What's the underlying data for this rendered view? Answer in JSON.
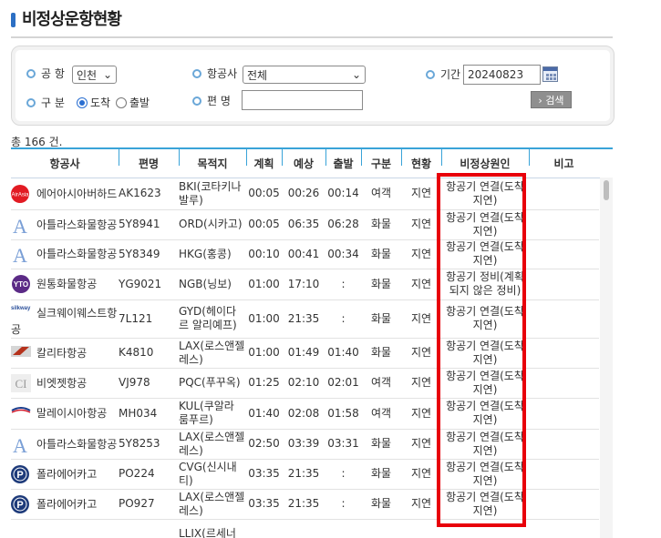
{
  "page": {
    "title": "비정상운항현황"
  },
  "search": {
    "airport_label": "공 항",
    "airport_value": "인천",
    "airline_label": "항공사",
    "airline_value": "전체",
    "period_label": "기간",
    "period_value": "20240823",
    "type_label": "구 분",
    "type_options": [
      "도착",
      "출발"
    ],
    "type_selected": "도착",
    "flight_label": "편 명",
    "flight_value": "",
    "search_button": "› 검색"
  },
  "total_text": "총 166 건.",
  "columns": [
    "항공사",
    "편명",
    "목적지",
    "계획",
    "예상",
    "출발",
    "구분",
    "현황",
    "비정상원인",
    "비고"
  ],
  "rows": [
    {
      "logo": "airasia-logo",
      "airline": [
        "에어아시아버하드"
      ],
      "flight": "AK1623",
      "dest": [
        "BKI(코타키나",
        "발루)"
      ],
      "plan": "00:05",
      "expect": "00:26",
      "depart": "00:14",
      "type": "여객",
      "status": "지연",
      "cause": [
        "항공기 연결(도착",
        "지연)"
      ],
      "note": ""
    },
    {
      "logo": "atlas-logo",
      "airline": [
        "아틀라스화물항공"
      ],
      "flight": "5Y8941",
      "dest": [
        "ORD(시카고)"
      ],
      "plan": "00:05",
      "expect": "06:35",
      "depart": "06:28",
      "type": "화물",
      "status": "지연",
      "cause": [
        "항공기 연결(도착",
        "지연)"
      ],
      "note": ""
    },
    {
      "logo": "atlas-logo",
      "airline": [
        "아틀라스화물항공"
      ],
      "flight": "5Y8349",
      "dest": [
        "HKG(홍콩)"
      ],
      "plan": "00:10",
      "expect": "00:41",
      "depart": "00:34",
      "type": "화물",
      "status": "지연",
      "cause": [
        "항공기 연결(도착",
        "지연)"
      ],
      "note": ""
    },
    {
      "logo": "yto-logo",
      "airline": [
        "원통화물항공"
      ],
      "flight": "YG9021",
      "dest": [
        "NGB(닝보)"
      ],
      "plan": "01:00",
      "expect": "17:10",
      "depart": ":",
      "type": "화물",
      "status": "지연",
      "cause": [
        "항공기 정비(계획",
        "되지 않은 정비)"
      ],
      "note": ""
    },
    {
      "logo": "silkway-logo",
      "airline": [
        "실크웨이웨스트항",
        "공"
      ],
      "flight": "7L121",
      "dest": [
        "GYD(헤이다",
        "르 알리예프)"
      ],
      "plan": "01:00",
      "expect": "21:35",
      "depart": ":",
      "type": "화물",
      "status": "지연",
      "cause": [
        "항공기 연결(도착",
        "지연)"
      ],
      "note": ""
    },
    {
      "logo": "kalitta-logo",
      "airline": [
        "칼리타항공"
      ],
      "flight": "K4810",
      "dest": [
        "LAX(로스앤젤",
        "레스)"
      ],
      "plan": "01:00",
      "expect": "01:49",
      "depart": "01:40",
      "type": "화물",
      "status": "지연",
      "cause": [
        "항공기 연결(도착",
        "지연)"
      ],
      "note": ""
    },
    {
      "logo": "vietjet-logo",
      "airline": [
        "비엣젯항공"
      ],
      "flight": "VJ978",
      "dest": [
        "PQC(푸꾸옥)"
      ],
      "plan": "01:25",
      "expect": "02:10",
      "depart": "02:01",
      "type": "여객",
      "status": "지연",
      "cause": [
        "항공기 연결(도착",
        "지연)"
      ],
      "note": ""
    },
    {
      "logo": "malaysia-logo",
      "airline": [
        "말레이시아항공"
      ],
      "flight": "MH034",
      "dest": [
        "KUL(쿠알라",
        "룸푸르)"
      ],
      "plan": "01:40",
      "expect": "02:08",
      "depart": "01:58",
      "type": "여객",
      "status": "지연",
      "cause": [
        "항공기 연결(도착",
        "지연)"
      ],
      "note": ""
    },
    {
      "logo": "atlas-logo",
      "airline": [
        "아틀라스화물항공"
      ],
      "flight": "5Y8253",
      "dest": [
        "LAX(로스앤젤",
        "레스)"
      ],
      "plan": "02:50",
      "expect": "03:39",
      "depart": "03:31",
      "type": "화물",
      "status": "지연",
      "cause": [
        "항공기 연결(도착",
        "지연)"
      ],
      "note": ""
    },
    {
      "logo": "polar-logo",
      "airline": [
        "폴라에어카고"
      ],
      "flight": "PO224",
      "dest": [
        "CVG(신시내",
        "티)"
      ],
      "plan": "03:35",
      "expect": "21:35",
      "depart": ":",
      "type": "화물",
      "status": "지연",
      "cause": [
        "항공기 연결(도착",
        "지연)"
      ],
      "note": ""
    },
    {
      "logo": "polar-logo",
      "airline": [
        "폴라에어카고"
      ],
      "flight": "PO927",
      "dest": [
        "LAX(로스앤젤",
        "레스)"
      ],
      "plan": "03:35",
      "expect": "21:35",
      "depart": ":",
      "type": "화물",
      "status": "지연",
      "cause": [
        "항공기 연결(도착",
        "지연)"
      ],
      "note": ""
    },
    {
      "logo": "",
      "airline": [
        ""
      ],
      "flight": "",
      "dest": [
        "LLIX(르세너",
        ""
      ],
      "plan": "",
      "expect": "",
      "depart": "",
      "type": "",
      "status": "",
      "cause": [
        "",
        ""
      ],
      "note": ""
    }
  ],
  "colors": {
    "accent": "#39a3d8",
    "highlight": "#e8000a",
    "title_bar": "#2c6fc4"
  }
}
